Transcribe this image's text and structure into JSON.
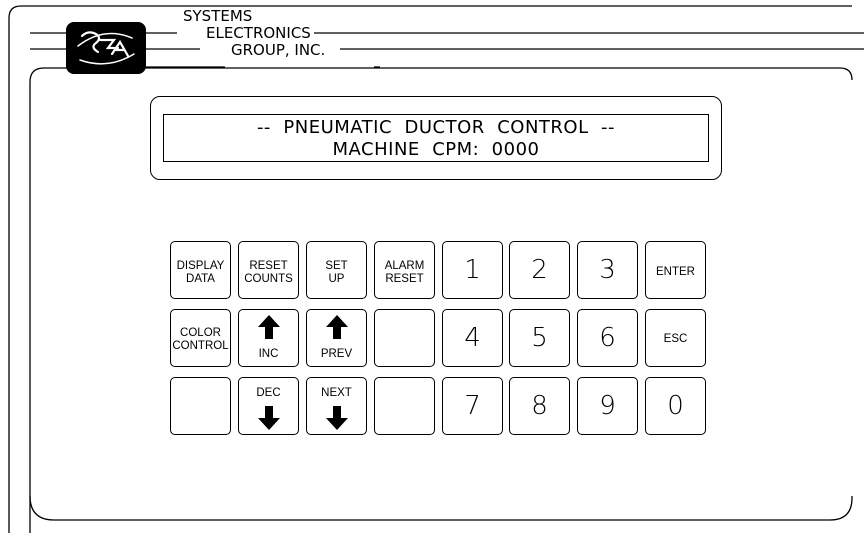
{
  "company": {
    "line1": "SYSTEMS",
    "line2": "ELECTRONICS",
    "line3": "GROUP,  INC."
  },
  "display": {
    "line1": "--  PNEUMATIC  DUCTOR  CONTROL  --",
    "line2": "MACHINE  CPM:  0000"
  },
  "keypad": {
    "display_data": [
      "DISPLAY",
      "DATA"
    ],
    "reset_counts": [
      "RESET",
      "COUNTS"
    ],
    "set_up": [
      "SET",
      "UP"
    ],
    "alarm_reset": [
      "ALARM",
      "RESET"
    ],
    "color_control": [
      "COLOR",
      "CONTROL"
    ],
    "inc": "INC",
    "prev": "PREV",
    "dec": "DEC",
    "next": "NEXT",
    "enter": "ENTER",
    "esc": "ESC",
    "digits": [
      "1",
      "2",
      "3",
      "4",
      "5",
      "6",
      "7",
      "8",
      "9",
      "0"
    ]
  },
  "icons": {
    "logo": "sega-logo-icon",
    "up": "arrow-up-icon",
    "down": "arrow-down-icon"
  }
}
